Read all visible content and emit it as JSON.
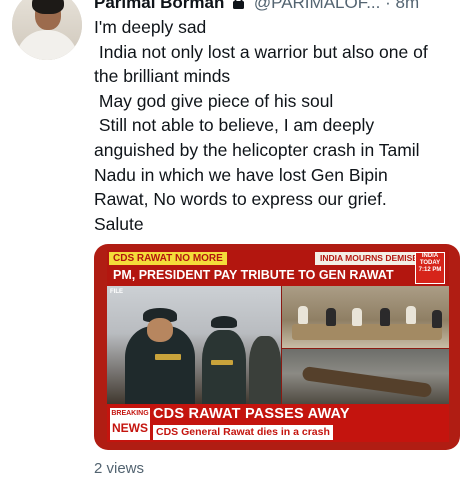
{
  "author": {
    "name": "Parimal Borman",
    "handle": "@PARIMALOF...",
    "separator": "·",
    "time": "8m"
  },
  "tweet": {
    "lines": [
      "I'm deeply sad",
      " India not only lost a warrior but also one of",
      "the brilliant minds",
      " May god give piece of his soul",
      " Still not able to believe, I am deeply",
      "anguished by the helicopter crash in Tamil",
      "Nadu in which we have lost Gen Bipin",
      "Rawat, No words to express our grief.",
      "Salute"
    ]
  },
  "media": {
    "tag_left": "CDS RAWAT NO MORE",
    "tag_mid": "INDIA MOURNS DEMISE",
    "headline": "PM, PRESIDENT PAY TRIBUTE TO GEN RAWAT",
    "file_tag": "FILE",
    "logo_line1": "INDIA",
    "logo_line2": "TODAY",
    "logo_time": "7:12 PM",
    "breaking_line1": "BREAKING",
    "breaking_line2": "NEWS",
    "main_caption": "CDS RAWAT PASSES AWAY",
    "sub_caption": "CDS General Rawat dies in a crash"
  },
  "footer": {
    "views": "2 views"
  },
  "colors": {
    "text": "#0f1419",
    "muted": "#536471",
    "news_red": "#c4140e",
    "news_yellow": "#f4dc3a"
  }
}
